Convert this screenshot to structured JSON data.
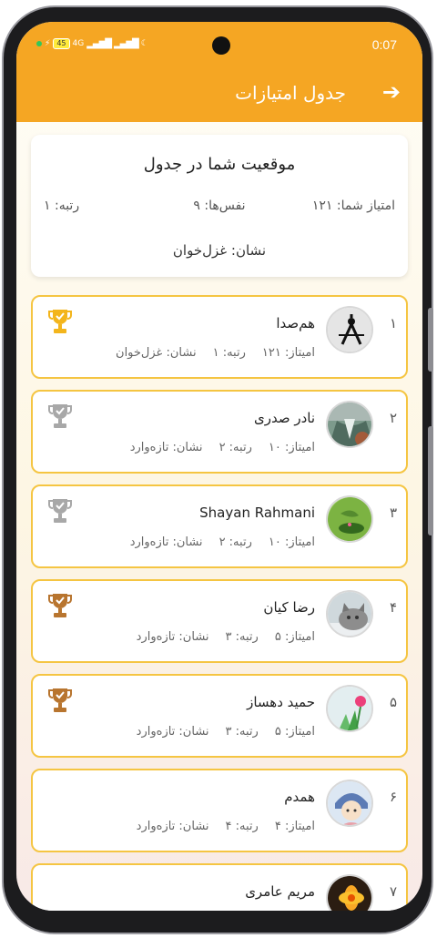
{
  "status": {
    "battery": "45",
    "network": "4G",
    "time": "0:07"
  },
  "appbar": {
    "title": "جدول امتیازات",
    "back_icon": "arrow-right-icon"
  },
  "position_card": {
    "title": "موقعیت شما در جدول",
    "score": "امتیاز شما: ۱۲۱",
    "breaths": "نفس‌ها: ۹",
    "rank": "رتبه: ۱",
    "badge": "نشان: غزل‌خوان"
  },
  "colors": {
    "accent": "#f5a623",
    "card_border": "#f5c542",
    "trophy_gold": "#f3b51c",
    "trophy_silver": "#a8a8a8",
    "trophy_bronze": "#b8752f"
  },
  "leaderboard": [
    {
      "rank": "۱",
      "name": "هم‌صدا",
      "score": "امیتاز: ۱۲۱",
      "level": "رتبه: ۱",
      "badge": "نشان: غزل‌خوان",
      "trophy": "gold",
      "avatar": "compass"
    },
    {
      "rank": "۲",
      "name": "نادر صدری",
      "score": "امیتاز: ۱۰",
      "level": "رتبه: ۲",
      "badge": "نشان: تازه‌وارد",
      "trophy": "silver",
      "avatar": "waterfall"
    },
    {
      "rank": "۳",
      "name": "Shayan Rahmani",
      "score": "امیتاز: ۱۰",
      "level": "رتبه: ۲",
      "badge": "نشان: تازه‌وارد",
      "trophy": "silver",
      "avatar": "leaf"
    },
    {
      "rank": "۴",
      "name": "رضا کیان",
      "score": "امیتاز: ۵",
      "level": "رتبه: ۳",
      "badge": "نشان: تازه‌وارد",
      "trophy": "bronze",
      "avatar": "cat"
    },
    {
      "rank": "۵",
      "name": "حمید دهساز",
      "score": "امیتاز: ۵",
      "level": "رتبه: ۳",
      "badge": "نشان: تازه‌وارد",
      "trophy": "bronze",
      "avatar": "flower"
    },
    {
      "rank": "۶",
      "name": "همدم",
      "score": "امیتاز: ۴",
      "level": "رتبه: ۴",
      "badge": "نشان: تازه‌وارد",
      "trophy": "none",
      "avatar": "girl"
    },
    {
      "rank": "۷",
      "name": "مریم عامری",
      "score": "",
      "level": "",
      "badge": "",
      "trophy": "none",
      "avatar": "yellow-flower"
    }
  ]
}
